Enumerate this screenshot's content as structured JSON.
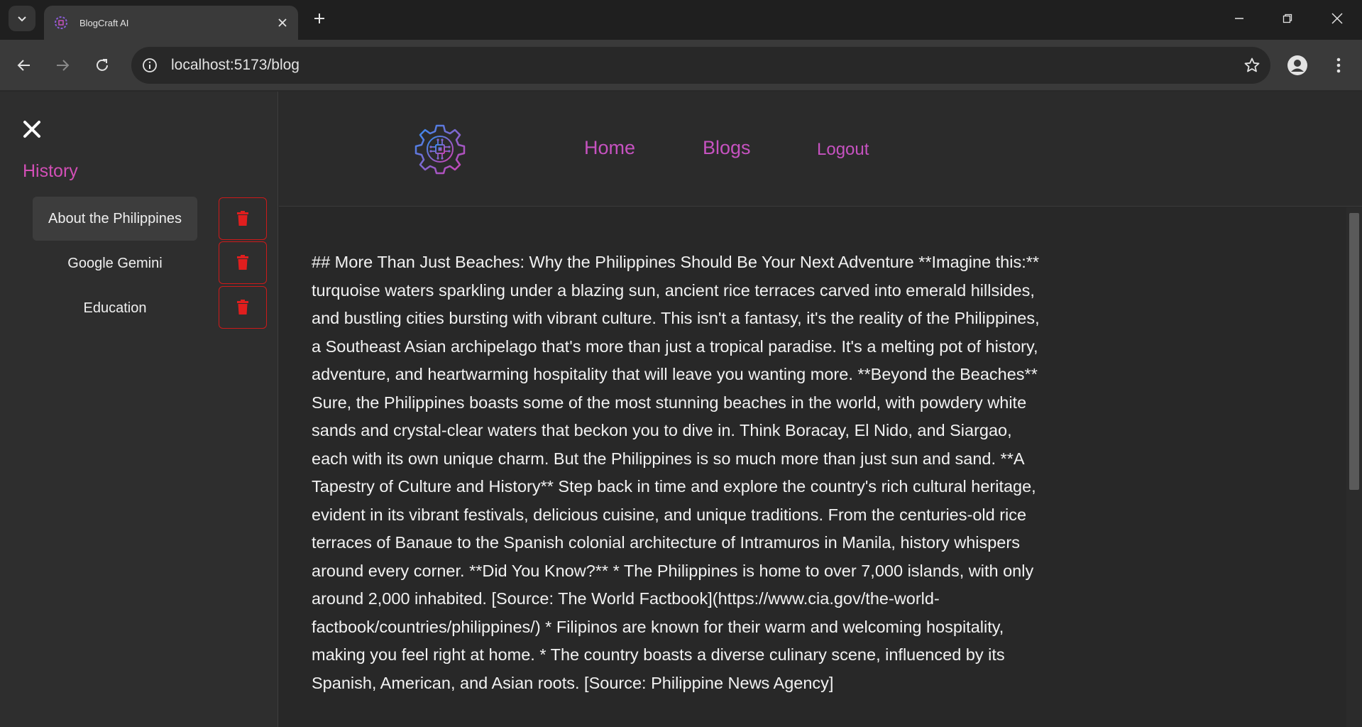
{
  "browser": {
    "tab_title": "BlogCraft AI",
    "url": "localhost:5173/blog"
  },
  "sidebar": {
    "history_label": "History",
    "items": [
      {
        "label": "About the Philippines",
        "active": true
      },
      {
        "label": "Google Gemini",
        "active": false
      },
      {
        "label": "Education",
        "active": false
      }
    ]
  },
  "header": {
    "nav": {
      "home": "Home",
      "blogs": "Blogs",
      "logout": "Logout"
    }
  },
  "blog": {
    "text": "## More Than Just Beaches: Why the Philippines Should Be Your Next Adventure **Imagine this:** turquoise waters sparkling under a blazing sun, ancient rice terraces carved into emerald hillsides, and bustling cities bursting with vibrant culture. This isn't a fantasy, it's the reality of the Philippines, a Southeast Asian archipelago that's more than just a tropical paradise. It's a melting pot of history, adventure, and heartwarming hospitality that will leave you wanting more. **Beyond the Beaches** Sure, the Philippines boasts some of the most stunning beaches in the world, with powdery white sands and crystal-clear waters that beckon you to dive in. Think Boracay, El Nido, and Siargao, each with its own unique charm. But the Philippines is so much more than just sun and sand. **A Tapestry of Culture and History** Step back in time and explore the country's rich cultural heritage, evident in its vibrant festivals, delicious cuisine, and unique traditions. From the centuries-old rice terraces of Banaue to the Spanish colonial architecture of Intramuros in Manila, history whispers around every corner. **Did You Know?** * The Philippines is home to over 7,000 islands, with only around 2,000 inhabited. [Source: The World Factbook](https://www.cia.gov/the-world-factbook/countries/philippines/) * Filipinos are known for their warm and welcoming hospitality, making you feel right at home. * The country boasts a diverse culinary scene, influenced by its Spanish, American, and Asian roots. [Source: Philippine News Agency]"
  },
  "colors": {
    "accent": "#c652c0",
    "history": "#d24fb6",
    "delete": "#e01e1e"
  }
}
